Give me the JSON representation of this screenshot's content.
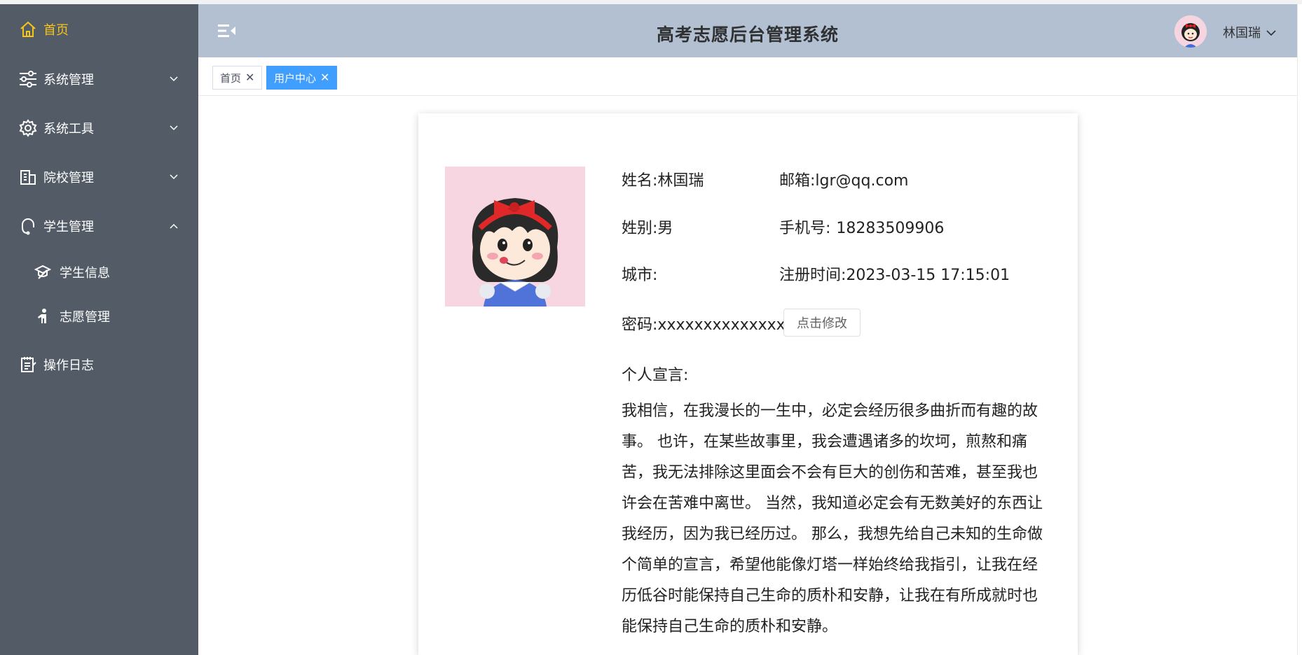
{
  "sidebar": {
    "home": "首页",
    "system_manage": "系统管理",
    "system_tools": "系统工具",
    "school_manage": "院校管理",
    "student_manage": "学生管理",
    "student_info": "学生信息",
    "volunteer_manage": "志愿管理",
    "operation_log": "操作日志"
  },
  "header": {
    "title": "高考志愿后台管理系统",
    "username": "林国瑞"
  },
  "tabs": [
    {
      "label": "首页",
      "close": "✕"
    },
    {
      "label": "用户中心",
      "close": "✕"
    }
  ],
  "profile": {
    "name_label": "姓名:",
    "name": "林国瑞",
    "email_label": "邮箱:",
    "email": "lgr@qq.com",
    "gender_label": "姓别:",
    "gender": "男",
    "phone_label": "手机号:",
    "phone": "18283509906",
    "city_label": "城市:",
    "city": "",
    "register_label": "注册时间:",
    "register_time": "2023-03-15 17:15:01",
    "password_label": "密码:",
    "password": "xxxxxxxxxxxxxx",
    "edit_button": "点击修改",
    "motto_label": "个人宣言:",
    "motto": "我相信，在我漫长的一生中，必定会经历很多曲折而有趣的故事。 也许，在某些故事里，我会遭遇诸多的坎坷，煎熬和痛苦，我无法排除这里面会不会有巨大的创伤和苦难，甚至我也许会在苦难中离世。 当然，我知道必定会有无数美好的东西让我经历，因为我已经历过。 那么，我想先给自己未知的生命做个简单的宣言，希望他能像灯塔一样始终给我指引，让我在经历低谷时能保持自己生命的质朴和安静，让我在有所成就时也能保持自己生命的质朴和安静。"
  },
  "colors": {
    "sidebar_bg": "#535c66",
    "header_bg": "#b3c0d1",
    "active_menu": "#f5c518",
    "tab_active": "#409eff"
  }
}
